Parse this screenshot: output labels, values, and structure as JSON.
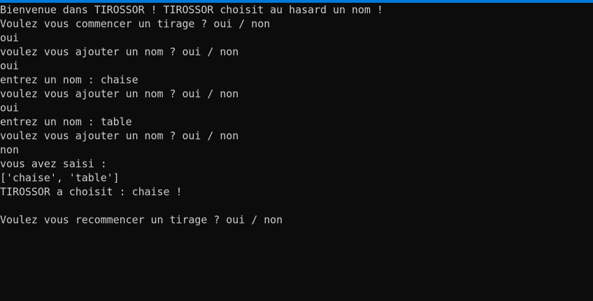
{
  "window": {
    "accent_color": "#0078d7",
    "background_color": "#0c0c0c",
    "text_color": "#cccccc"
  },
  "console": {
    "lines": [
      "Bienvenue dans TIROSSOR ! TIROSSOR choisit au hasard un nom !",
      "Voulez vous commencer un tirage ? oui / non",
      "oui",
      "voulez vous ajouter un nom ? oui / non",
      "oui",
      "entrez un nom : chaise",
      "voulez vous ajouter un nom ? oui / non",
      "oui",
      "entrez un nom : table",
      "voulez vous ajouter un nom ? oui / non",
      "non",
      "vous avez saisi :",
      "['chaise', 'table']",
      "TIROSSOR a choisit : chaise !",
      "",
      "Voulez vous recommencer un tirage ? oui / non"
    ]
  }
}
